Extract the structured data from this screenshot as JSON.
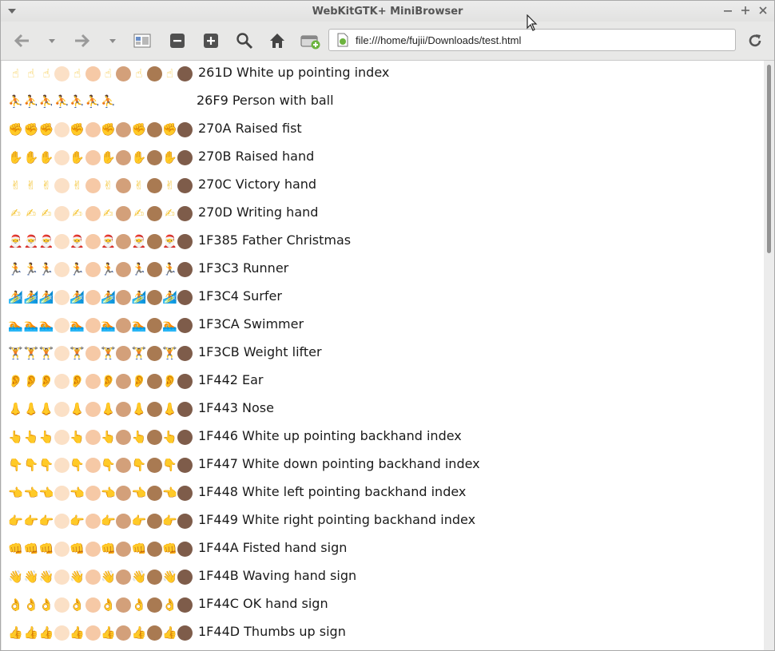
{
  "window": {
    "title": "WebKitGTK+ MiniBrowser"
  },
  "url": {
    "value": "file:///home/fujii/Downloads/test.html"
  },
  "icons": {
    "back": "arrow-left-icon",
    "forward": "arrow-right-icon",
    "dropdown": "chevron-down-icon",
    "view": "view-mode-icon",
    "zoom_out": "zoom-out-icon",
    "zoom_in": "zoom-in-icon",
    "find": "search-icon",
    "home": "home-icon",
    "new_tab": "new-tab-icon",
    "reload": "reload-icon",
    "file": "file-icon"
  },
  "rows": [
    {
      "label": "261D White up pointing index",
      "glyph": "☝",
      "color": "#f5c63b"
    },
    {
      "label": "26F9 Person with ball",
      "glyph": "⛹",
      "color": "#e6a43a",
      "no_tones": true
    },
    {
      "label": "270A Raised fist",
      "glyph": "✊",
      "color": "#f5c63b"
    },
    {
      "label": "270B Raised hand",
      "glyph": "✋",
      "color": "#f5c63b"
    },
    {
      "label": "270C Victory hand",
      "glyph": "✌",
      "color": "#f5c63b"
    },
    {
      "label": "270D Writing hand",
      "glyph": "✍",
      "color": "#f5c63b"
    },
    {
      "label": "1F385 Father Christmas",
      "glyph": "🎅",
      "color": "#d93a3a"
    },
    {
      "label": "1F3C3 Runner",
      "glyph": "🏃",
      "color": "#4a8a3a"
    },
    {
      "label": "1F3C4 Surfer",
      "glyph": "🏄",
      "color": "#3a8ad4"
    },
    {
      "label": "1F3CA Swimmer",
      "glyph": "🏊",
      "color": "#3a8ad4"
    },
    {
      "label": "1F3CB Weight lifter",
      "glyph": "🏋",
      "color": "#4a8a3a"
    },
    {
      "label": "1F442 Ear",
      "glyph": "👂",
      "color": "#f5c63b"
    },
    {
      "label": "1F443 Nose",
      "glyph": "👃",
      "color": "#f5c63b"
    },
    {
      "label": "1F446 White up pointing backhand index",
      "glyph": "👆",
      "color": "#f5c63b"
    },
    {
      "label": "1F447 White down pointing backhand index",
      "glyph": "👇",
      "color": "#f5c63b"
    },
    {
      "label": "1F448 White left pointing backhand index",
      "glyph": "👈",
      "color": "#f5c63b"
    },
    {
      "label": "1F449 White right pointing backhand index",
      "glyph": "👉",
      "color": "#f5c63b"
    },
    {
      "label": "1F44A Fisted hand sign",
      "glyph": "👊",
      "color": "#f5c63b"
    },
    {
      "label": "1F44B Waving hand sign",
      "glyph": "👋",
      "color": "#f5c63b"
    },
    {
      "label": "1F44C OK hand sign",
      "glyph": "👌",
      "color": "#f5c63b"
    },
    {
      "label": "1F44D Thumbs up sign",
      "glyph": "👍",
      "color": "#f5c63b"
    }
  ],
  "skin_tones": [
    "#fbe0c6",
    "#f6c9a6",
    "#d3a07a",
    "#a97a52",
    "#7e5c4a"
  ]
}
